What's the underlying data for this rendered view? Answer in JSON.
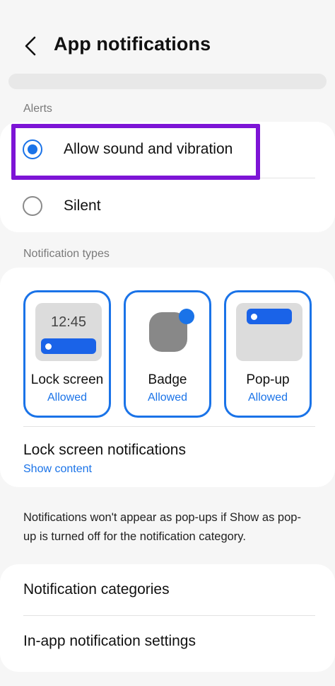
{
  "header": {
    "title": "App notifications",
    "back_icon": "chevron-left-icon"
  },
  "alerts": {
    "label": "Alerts",
    "options": [
      {
        "label": "Allow sound and vibration",
        "selected": true
      },
      {
        "label": "Silent",
        "selected": false
      }
    ]
  },
  "notification_types": {
    "label": "Notification types",
    "tiles": [
      {
        "name": "Lock screen",
        "status": "Allowed",
        "preview_time": "12:45"
      },
      {
        "name": "Badge",
        "status": "Allowed"
      },
      {
        "name": "Pop-up",
        "status": "Allowed"
      }
    ],
    "lock_screen_notifications": {
      "title": "Lock screen notifications",
      "value": "Show content"
    }
  },
  "info": "Notifications won't appear as pop-ups if Show as pop-up is turned off for the notification category.",
  "bottom_list": [
    {
      "label": "Notification categories"
    },
    {
      "label": "In-app notification settings"
    }
  ],
  "colors": {
    "accent": "#1a73e8",
    "highlight": "#7d14d6",
    "background": "#f6f6f6"
  }
}
